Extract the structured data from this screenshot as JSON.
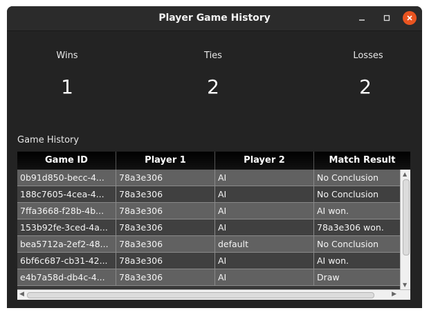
{
  "window": {
    "title": "Player Game History",
    "controls": {
      "minimize_icon": "minimize-icon",
      "maximize_icon": "maximize-icon",
      "close_icon": "close-icon"
    }
  },
  "stats": {
    "wins": {
      "label": "Wins",
      "value": "1"
    },
    "ties": {
      "label": "Ties",
      "value": "2"
    },
    "losses": {
      "label": "Losses",
      "value": "2"
    }
  },
  "history": {
    "label": "Game History",
    "columns": [
      "Game ID",
      "Player 1",
      "Player 2",
      "Match Result"
    ],
    "rows": [
      [
        "0b91d850-becc-4...",
        "78a3e306",
        "AI",
        "No Conclusion"
      ],
      [
        "188c7605-4cea-4...",
        "78a3e306",
        "AI",
        "No Conclusion"
      ],
      [
        "7ffa3668-f28b-4b...",
        "78a3e306",
        "AI",
        "AI won."
      ],
      [
        "153b92fe-3ced-4a...",
        "78a3e306",
        "AI",
        "78a3e306 won."
      ],
      [
        "bea5712a-2ef2-48...",
        "78a3e306",
        "default",
        "No Conclusion"
      ],
      [
        "6bf6c687-cb31-42...",
        "78a3e306",
        "AI",
        "AI won."
      ],
      [
        "e4b7a58d-db4c-4...",
        "78a3e306",
        "AI",
        "Draw"
      ]
    ]
  },
  "colors": {
    "close_button": "#e95420",
    "window_bg": "#232323",
    "header_bg": "#000000"
  }
}
